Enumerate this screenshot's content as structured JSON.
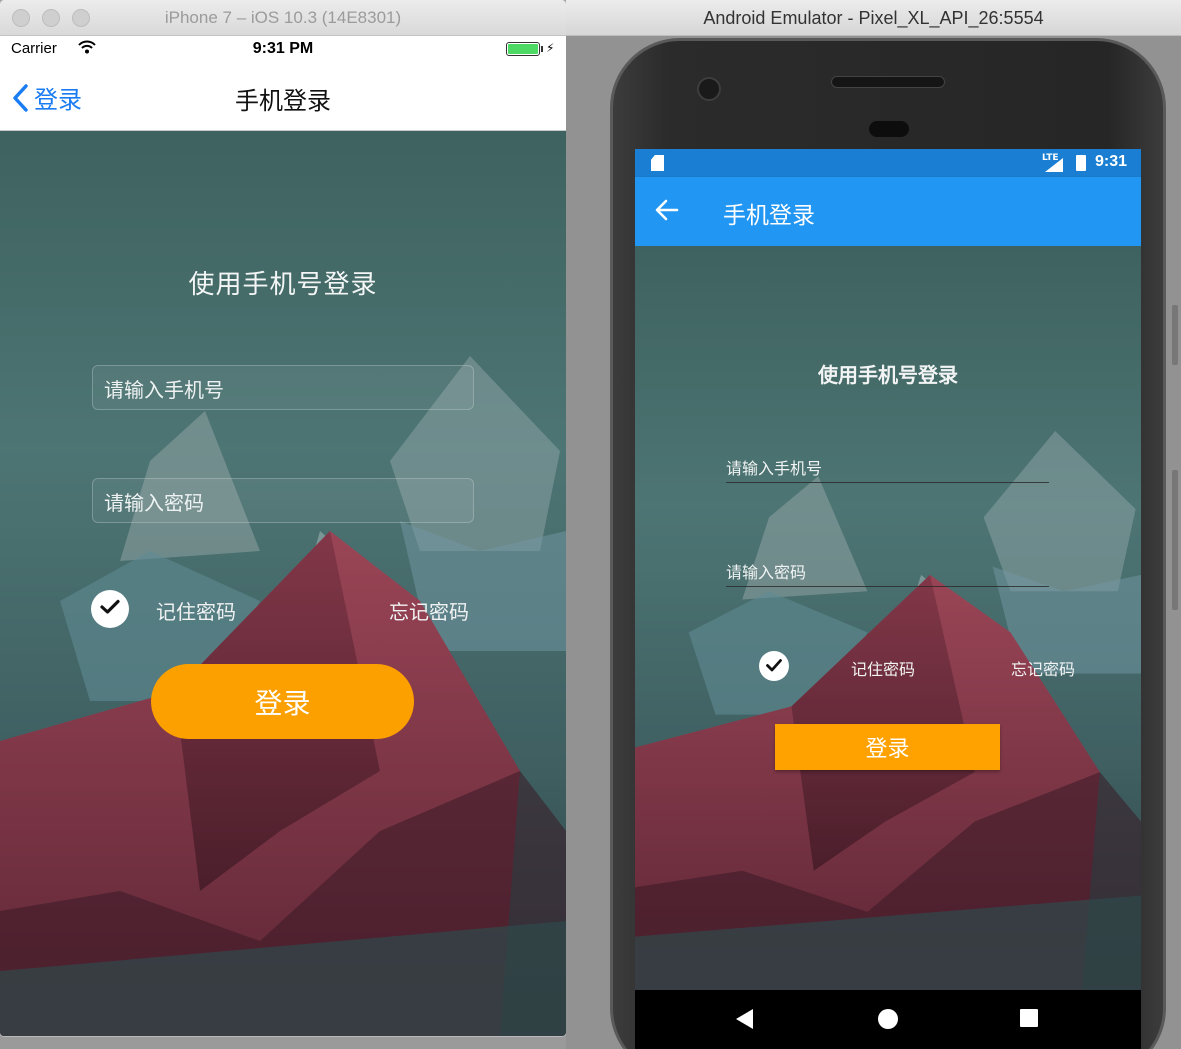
{
  "ios": {
    "window_title": "iPhone 7 – iOS 10.3 (14E8301)",
    "status": {
      "carrier": "Carrier",
      "time": "9:31 PM"
    },
    "nav": {
      "back_label": "登录",
      "title": "手机登录"
    },
    "heading": "使用手机号登录",
    "phone_placeholder": "请输入手机号",
    "password_placeholder": "请输入密码",
    "remember_label": "记住密码",
    "forgot_label": "忘记密码",
    "login_button": "登录",
    "colors": {
      "accent": "#1a7cf3",
      "button": "#fca000"
    }
  },
  "android": {
    "window_title": "Android Emulator - Pixel_XL_API_26:5554",
    "status": {
      "network": "LTE",
      "time": "9:31"
    },
    "appbar": {
      "title": "手机登录"
    },
    "heading": "使用手机号登录",
    "phone_placeholder": "请输入手机号",
    "password_placeholder": "请输入密码",
    "remember_label": "记住密码",
    "forgot_label": "忘记密码",
    "login_button": "登录",
    "colors": {
      "appbar": "#2196f3",
      "statusbar": "#1a7fd2",
      "button": "#ffa200"
    }
  }
}
